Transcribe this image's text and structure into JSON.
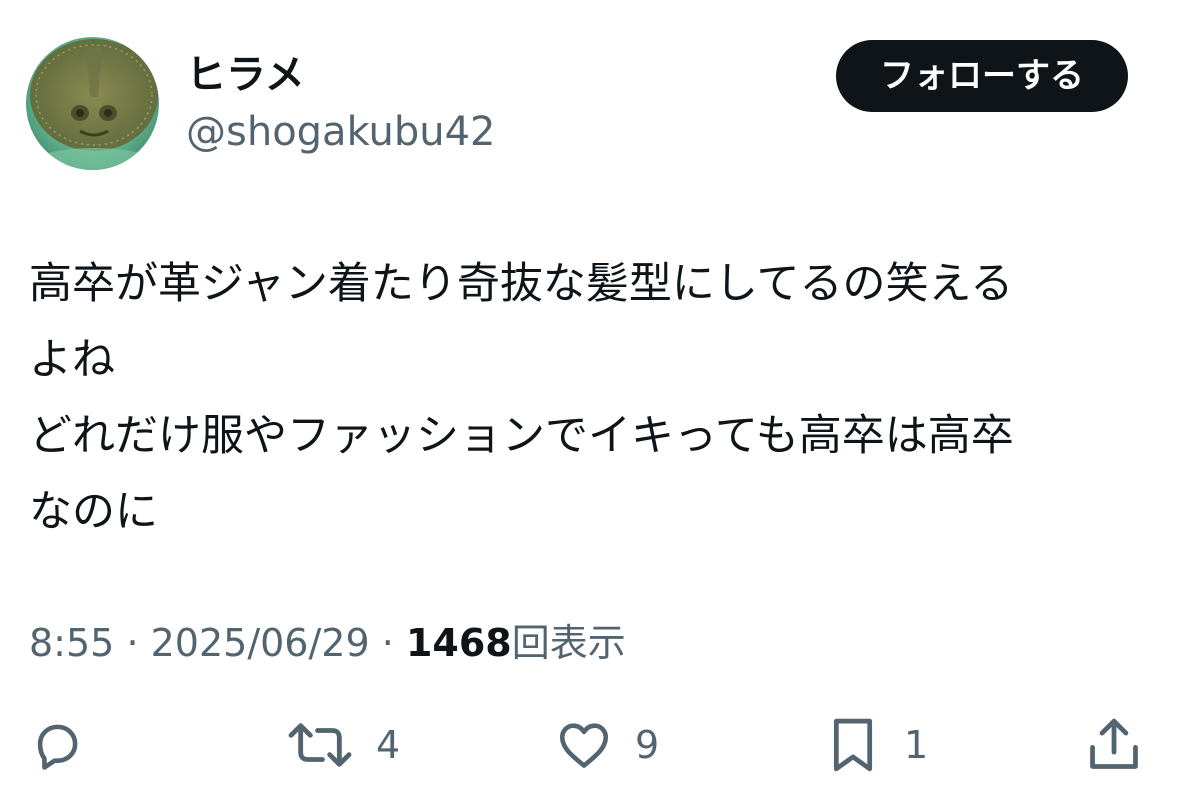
{
  "user": {
    "display_name": "ヒラメ",
    "handle": "@shogakubu42",
    "avatar": "flounder-photo"
  },
  "follow_button": {
    "label": "フォローする"
  },
  "tweet": {
    "lines": [
      "高卒が革ジャン着たり奇抜な髪型にしてるの笑える",
      "よね",
      "どれだけ服やファッションでイキっても高卒は高卒",
      "なのに"
    ]
  },
  "meta": {
    "time": "8:55",
    "separator": "·",
    "date": "2025/06/29",
    "views_count": "1468",
    "views_label": "回表示"
  },
  "actions": {
    "reply": {
      "icon": "reply-icon"
    },
    "retweet": {
      "icon": "retweet-icon",
      "count": "4"
    },
    "like": {
      "icon": "heart-icon",
      "count": "9"
    },
    "bookmark": {
      "icon": "bookmark-icon",
      "count": "1"
    },
    "share": {
      "icon": "share-icon"
    }
  },
  "colors": {
    "text": "#0f1419",
    "secondary": "#536471",
    "button_bg": "#0f1419",
    "button_text": "#ffffff"
  }
}
